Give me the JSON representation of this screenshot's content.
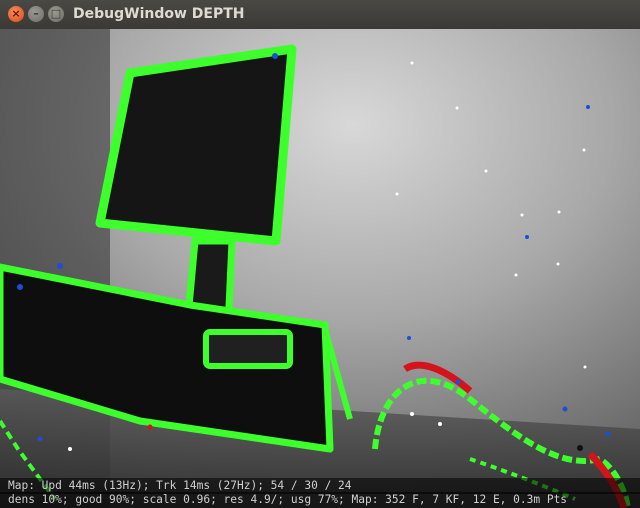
{
  "window": {
    "title": "DebugWindow DEPTH",
    "close_glyph": "×",
    "min_glyph": "–",
    "max_glyph": "□"
  },
  "status": {
    "line1": "Map: Upd  44ms (13Hz); Trk  14ms (27Hz); 54 / 30 / 24",
    "line2": "dens 10%; good 90%; scale 0.96; res 4.9/; usg 77%; Map: 352 F, 7 KF, 12 E, 0.3m Pts"
  },
  "colors": {
    "tracked_points": "#3cff2c",
    "uncertain_points": "#1a4fd6",
    "high_depth": "#d4131b",
    "white_points": "#ffffff"
  }
}
